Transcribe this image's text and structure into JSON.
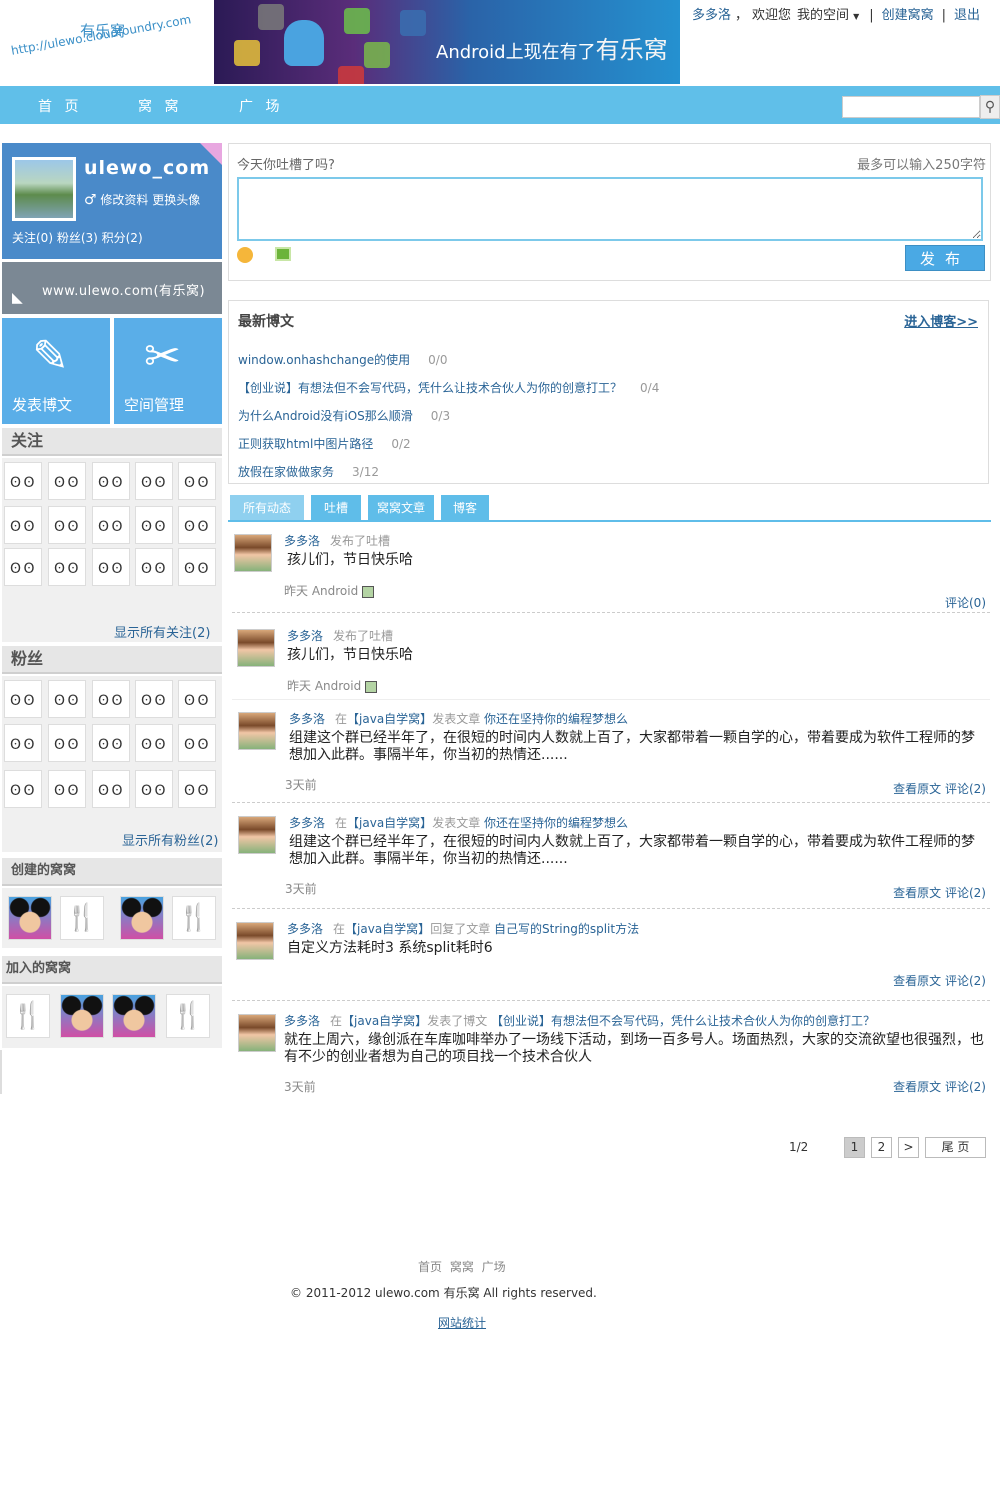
{
  "header": {
    "logo_title": "有乐窝",
    "logo_url": "http://ulewo.cloudfoundry.com",
    "banner_text": "Android上现在有了",
    "banner_brand": "有乐窝",
    "user": "多多洛",
    "comma": "，",
    "welcome": "欢迎您",
    "my_space": "我的空间",
    "create": "创建窝窝",
    "logout": "退出"
  },
  "nav": {
    "home": "首 页",
    "wowo": "窝 窝",
    "square": "广 场"
  },
  "profile": {
    "username": "ulewo_com",
    "gender_icon": "♂",
    "edit": "修改资料",
    "avatar": "更换头像",
    "counts": "关注(0) 粉丝(3) 积分(2)"
  },
  "rss": {
    "text": "www.ulewo.com(有乐窝)"
  },
  "tiles": {
    "post": "发表博文",
    "manage": "空间管理"
  },
  "follow": {
    "title": "关注",
    "show_all": "显示所有关注(2)"
  },
  "fans": {
    "title": "粉丝",
    "show_all": "显示所有粉丝(2)"
  },
  "created": {
    "title": "创建的窝窝"
  },
  "joined": {
    "title": "加入的窝窝"
  },
  "postbox": {
    "prompt": "今天你吐槽了吗?",
    "limit": "最多可以输入250字符",
    "send": "发布"
  },
  "blogs": {
    "title": "最新博文",
    "more": "进入博客>>",
    "items": [
      {
        "title": "window.onhashchange的使用",
        "count": "0/0"
      },
      {
        "title": "【创业说】有想法但不会写代码，凭什么让技术合伙人为你的创意打工？",
        "count": "0/4"
      },
      {
        "title": "为什么Android没有iOS那么顺滑",
        "count": "0/3"
      },
      {
        "title": "正则获取html中图片路径",
        "count": "0/2"
      },
      {
        "title": "放假在家做做家务",
        "count": "3/12"
      }
    ]
  },
  "tabs": [
    "所有动态",
    "吐槽",
    "窝窝文章",
    "博客"
  ],
  "feed": [
    {
      "user": "多多洛",
      "action": "发布了吐槽",
      "body": "孩儿们，节日快乐哈",
      "time": "昨天 Android",
      "link": "评论(0)"
    },
    {
      "user": "多多洛",
      "action": "发布了吐槽",
      "body": "孩儿们，节日快乐哈",
      "time": "昨天 Android",
      "link": ""
    },
    {
      "user": "多多洛",
      "in": "在",
      "group": "【java自学窝】",
      "action": "发表文章",
      "title": "你还在坚持你的编程梦想么",
      "body": "组建这个群已经半年了，在很短的时间内人数就上百了，大家都带着一颗自学的心，带着要成为软件工程师的梦想加入此群。事隔半年，你当初的热情还......",
      "time": "3天前",
      "link": "查看原文 评论(2)"
    },
    {
      "user": "多多洛",
      "in": "在",
      "group": "【java自学窝】",
      "action": "发表文章",
      "title": "你还在坚持你的编程梦想么",
      "body": "组建这个群已经半年了，在很短的时间内人数就上百了，大家都带着一颗自学的心，带着要成为软件工程师的梦想加入此群。事隔半年，你当初的热情还......",
      "time": "3天前",
      "link": "查看原文 评论(2)"
    },
    {
      "user": "多多洛",
      "in": "在",
      "group": "【java自学窝】",
      "action": "回复了文章",
      "title": "自己写的String的split方法",
      "body": "自定义方法耗时3 系统split耗时6",
      "time": "",
      "link": "查看原文 评论(2)"
    },
    {
      "user": "多多洛",
      "in": "在",
      "group": "【java自学窝】",
      "action": "发表了博文",
      "title": "【创业说】有想法但不会写代码，凭什么让技术合伙人为你的创意打工？",
      "body": "就在上周六，缘创派在车库咖啡举办了一场线下活动，到场一百多号人。场面热烈，大家的交流欲望也很强烈，也有不少的创业者想为自己的项目找一个技术合伙人",
      "time": "3天前",
      "link": "查看原文 评论(2)"
    }
  ],
  "pager": {
    "info": "1/2",
    "p1": "1",
    "p2": "2",
    "next": ">",
    "last": "尾 页"
  },
  "footer": {
    "links": "首页 窝窝 广场",
    "copyright": "© 2011-2012 ulewo.com 有乐窝 All rights reserved.",
    "stats": "网站统计"
  }
}
